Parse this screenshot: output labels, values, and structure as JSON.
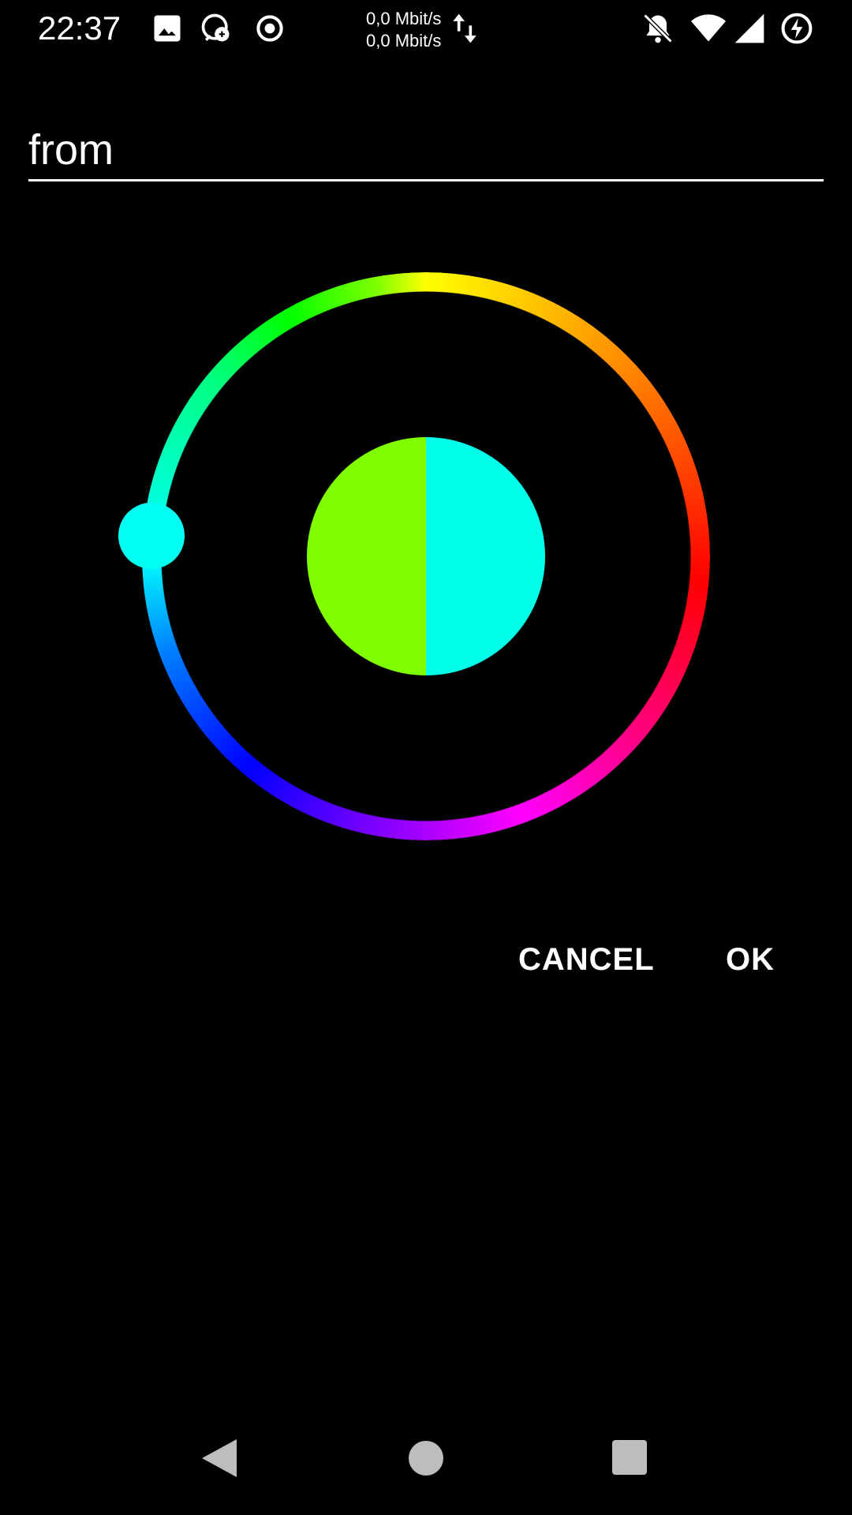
{
  "status_bar": {
    "time": "22:37",
    "net_up": "0,0 Mbit/s",
    "net_down": "0,0 Mbit/s",
    "icons": [
      "image-icon",
      "messenger-icon",
      "record-icon",
      "data-arrows-icon",
      "notifications-off-icon",
      "wifi-icon",
      "signal-icon",
      "battery-charging-icon"
    ]
  },
  "dialog": {
    "title_value": "from",
    "colors": {
      "previous": "#80ff00",
      "selected": "#00ffe8",
      "handle": "#00fff0"
    },
    "cancel_label": "CANCEL",
    "ok_label": "OK"
  },
  "nav_bar": {
    "icons": [
      "back-icon",
      "home-icon",
      "recents-icon"
    ]
  }
}
